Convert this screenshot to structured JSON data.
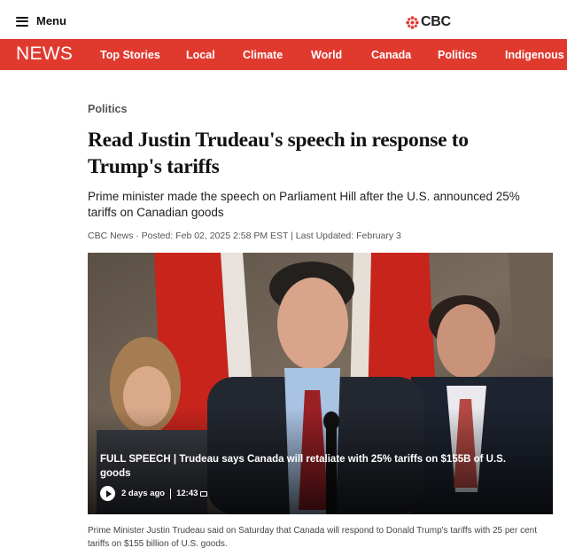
{
  "header": {
    "menu_label": "Menu",
    "logo_text": "CBC"
  },
  "nav": {
    "section_logo": "NEWS",
    "items": [
      {
        "label": "Top Stories"
      },
      {
        "label": "Local"
      },
      {
        "label": "Climate"
      },
      {
        "label": "World"
      },
      {
        "label": "Canada"
      },
      {
        "label": "Politics"
      },
      {
        "label": "Indigenous"
      }
    ]
  },
  "article": {
    "category": "Politics",
    "headline": "Read Justin Trudeau's speech in response to Trump's tariffs",
    "deck": "Prime minister made the speech on Parliament Hill after the U.S. announced 25% tariffs on Canadian goods",
    "byline": "CBC News · Posted: Feb 02, 2025 2:58 PM EST | Last Updated: February 3"
  },
  "video": {
    "caption": "FULL SPEECH | Trudeau says Canada will retaliate with 25% tariffs on $155B of U.S. goods",
    "age": "2 days ago",
    "duration": "12:43"
  },
  "photo_caption": "Prime Minister Justin Trudeau said on Saturday that Canada will respond to Donald Trump's tariffs with 25 per cent tariffs on $155 billion of U.S. goods.",
  "colors": {
    "brand_red": "#e03a2f",
    "text_dark": "#111111",
    "text_muted": "#555555"
  }
}
